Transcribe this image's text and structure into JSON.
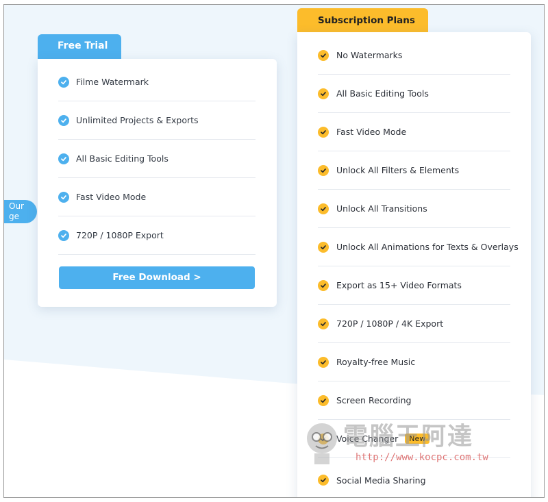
{
  "side_pill": {
    "line1": "Our",
    "line2": "ge"
  },
  "free_trial": {
    "tab_label": "Free Trial",
    "features": [
      "Filme Watermark",
      "Unlimited Projects & Exports",
      "All Basic Editing Tools",
      "Fast Video Mode",
      "720P / 1080P Export"
    ],
    "button_label": "Free Download >"
  },
  "subscription": {
    "tab_label": "Subscription Plans",
    "features": [
      "No Watermarks",
      "All Basic Editing Tools",
      "Fast Video Mode",
      "Unlock All Filters & Elements",
      "Unlock All Transitions",
      "Unlock All Animations for Texts & Overlays",
      "Export as 15+ Video Formats",
      "720P / 1080P / 4K Export",
      "Royalty-free Music",
      "Screen Recording",
      "Voice Changer",
      "Social Media Sharing"
    ],
    "new_badge": "New"
  },
  "watermark": {
    "title": "電腦王阿達",
    "url": "http://www.kocpc.com.tw"
  },
  "colors": {
    "blue": "#4db0ee",
    "yellow": "#fcbc2b",
    "bg_tint": "#eef6fc"
  },
  "icons": {
    "check": "check-circle-icon"
  }
}
